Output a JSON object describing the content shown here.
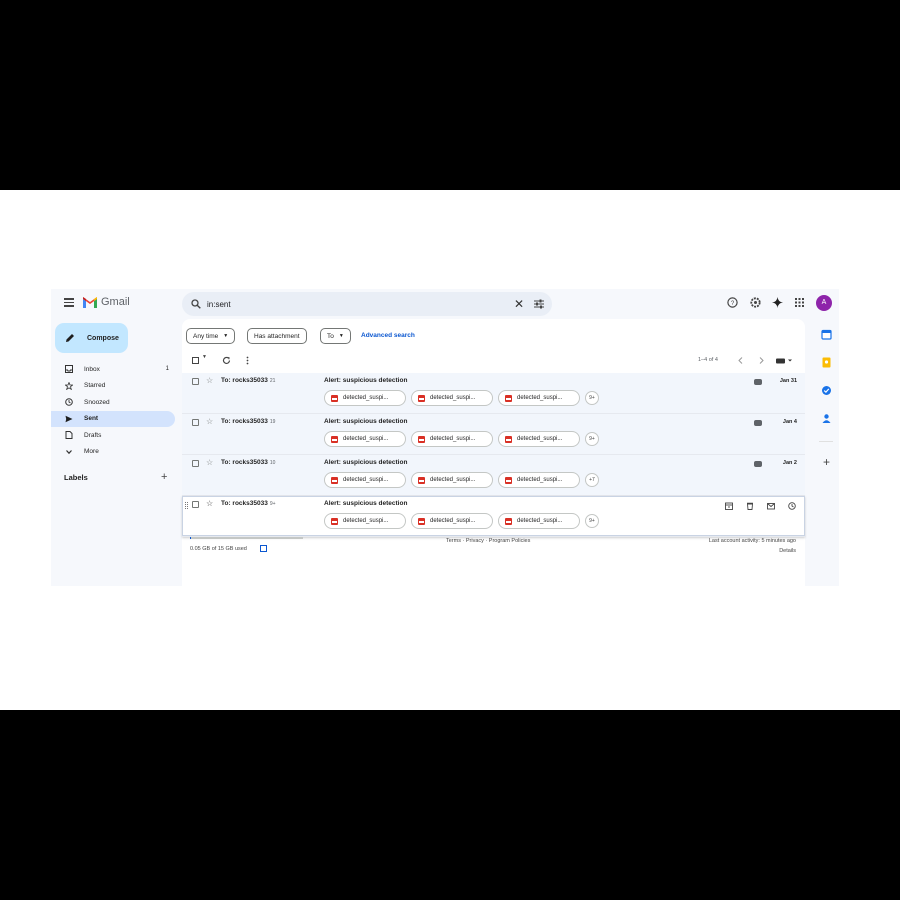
{
  "app": {
    "logo_text": "Gmail"
  },
  "search": {
    "value": "in:sent"
  },
  "compose": {
    "label": "Compose"
  },
  "nav": [
    {
      "label": "Inbox",
      "count": "1",
      "icon": "inbox-icon",
      "active": false
    },
    {
      "label": "Starred",
      "count": "",
      "icon": "star-icon",
      "active": false
    },
    {
      "label": "Snoozed",
      "count": "",
      "icon": "clock-icon",
      "active": false
    },
    {
      "label": "Sent",
      "count": "",
      "icon": "send-icon",
      "active": true
    },
    {
      "label": "Drafts",
      "count": "",
      "icon": "draft-icon",
      "active": false
    },
    {
      "label": "More",
      "count": "",
      "icon": "chevron-down-icon",
      "active": false
    }
  ],
  "labels": {
    "title": "Labels",
    "add": "+"
  },
  "filters": {
    "any_time": "Any time",
    "has_attachment": "Has attachment",
    "to": "To",
    "advanced": "Advanced search"
  },
  "toolbar": {
    "pagination": "1–4 of 4"
  },
  "rows": [
    {
      "to": "To: rocks35033",
      "count": "21",
      "subject": "Alert: suspicious detection",
      "date": "Jan 31",
      "attachments": [
        "detected_suspi...",
        "detected_suspi...",
        "detected_suspi..."
      ],
      "more": "9+"
    },
    {
      "to": "To: rocks35033",
      "count": "19",
      "subject": "Alert: suspicious detection",
      "date": "Jan 4",
      "attachments": [
        "detected_suspi...",
        "detected_suspi...",
        "detected_suspi..."
      ],
      "more": "9+"
    },
    {
      "to": "To: rocks35033",
      "count": "10",
      "subject": "Alert: suspicious detection",
      "date": "Jan 2",
      "attachments": [
        "detected_suspi...",
        "detected_suspi...",
        "detected_suspi..."
      ],
      "more": "+7"
    },
    {
      "to": "To: rocks35033",
      "count": "9+",
      "subject": "Alert: suspicious detection",
      "date": "",
      "attachments": [
        "detected_suspi...",
        "detected_suspi...",
        "detected_suspi..."
      ],
      "more": "9+"
    }
  ],
  "footer": {
    "storage": "0.05 GB of 15 GB used",
    "storage_fraction": 0.003,
    "terms": "Terms · Privacy · Program Policies",
    "activity": "Last account activity: 5 minutes ago",
    "details": "Details"
  },
  "avatar": {
    "initial": "A"
  },
  "colors": {
    "accent": "#0b57d0",
    "compose_bg": "#c2e7ff",
    "active_nav": "#d3e3fd",
    "avatar": "#8e24aa",
    "attachment_icon": "#d93025"
  }
}
